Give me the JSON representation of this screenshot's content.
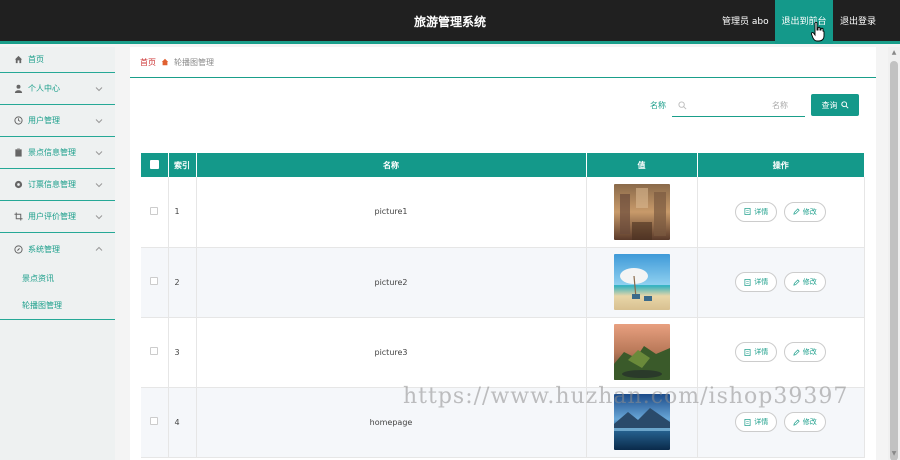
{
  "header": {
    "title": "旅游管理系统",
    "admin_label": "管理员 abo",
    "front_label": "退出到前台",
    "logout_label": "退出登录"
  },
  "sidebar": {
    "items": [
      {
        "label": "首页",
        "icon": "home-icon"
      },
      {
        "label": "个人中心",
        "icon": "user-icon"
      },
      {
        "label": "用户管理",
        "icon": "clock-icon"
      },
      {
        "label": "景点信息管理",
        "icon": "clipboard-icon"
      },
      {
        "label": "订票信息管理",
        "icon": "location-icon"
      },
      {
        "label": "用户评价管理",
        "icon": "crop-icon"
      },
      {
        "label": "系统管理",
        "icon": "compass-icon"
      }
    ],
    "sub_items": [
      "景点资讯",
      "轮播图管理"
    ]
  },
  "breadcrumb": {
    "home": "首页",
    "current": "轮播图管理"
  },
  "search": {
    "label": "名称",
    "placeholder": "名称",
    "button": "查询"
  },
  "table": {
    "columns": [
      "索引",
      "名称",
      "值",
      "操作"
    ],
    "rows": [
      {
        "index": "1",
        "name": "picture1"
      },
      {
        "index": "2",
        "name": "picture2"
      },
      {
        "index": "3",
        "name": "picture3"
      },
      {
        "index": "4",
        "name": "homepage"
      }
    ],
    "detail_label": "详情",
    "edit_label": "修改"
  },
  "watermark": "https://www.huzhan.com/ishop39397",
  "colors": {
    "accent": "#14998a",
    "topbar": "#202020"
  }
}
